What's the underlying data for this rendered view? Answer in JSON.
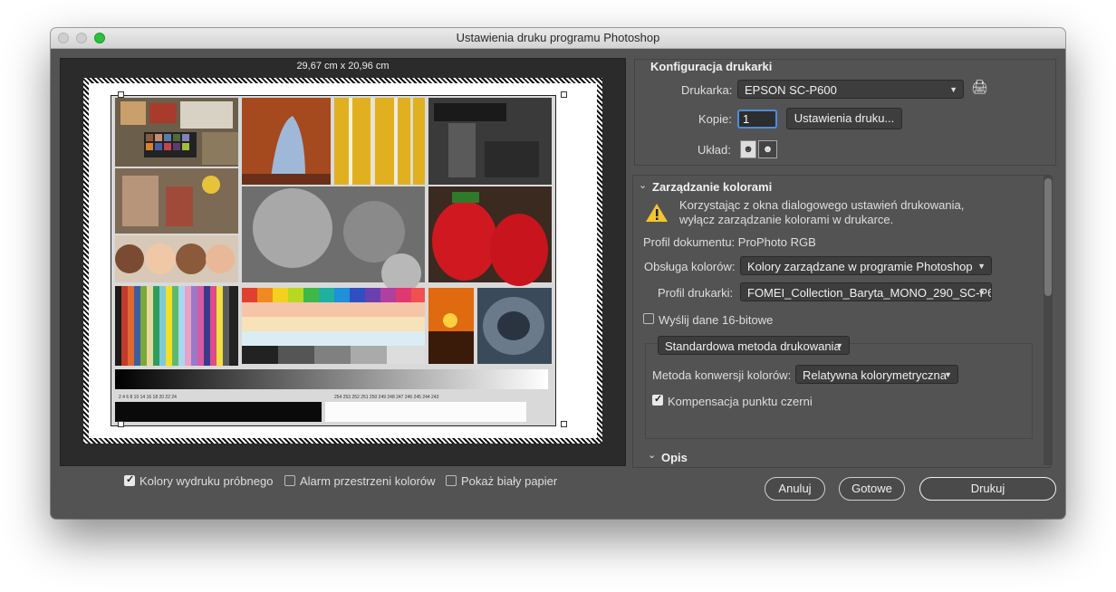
{
  "window": {
    "title": "Ustawienia druku programu Photoshop"
  },
  "preview": {
    "paper_size": "29,67 cm x 20,96 cm"
  },
  "printer_setup": {
    "heading": "Konfiguracja drukarki",
    "printer_label": "Drukarka:",
    "printer_value": "EPSON SC-P600",
    "copies_label": "Kopie:",
    "copies_value": "1",
    "print_settings_button": "Ustawienia druku...",
    "layout_label": "Układ:",
    "add_printer_icon": "add-printer-icon",
    "portrait_icon": "portrait-orientation-icon",
    "landscape_icon": "landscape-orientation-icon"
  },
  "color_management": {
    "heading": "Zarządzanie kolorami",
    "warning_line1": "Korzystając z okna dialogowego ustawień drukowania,",
    "warning_line2": "wyłącz zarządzanie kolorami w drukarce.",
    "doc_profile": "Profil dokumentu: ProPhoto RGB",
    "color_handling_label": "Obsługa kolorów:",
    "color_handling_value": "Kolory zarządzane w programie Photoshop",
    "printer_profile_label": "Profil drukarki:",
    "printer_profile_value": "FOMEI_Collection_Baryta_MONO_290_SC-P6...",
    "send_16bit_label": "Wyślij dane 16-bitowe",
    "send_16bit_checked": false,
    "print_method_value": "Standardowa metoda drukowania",
    "rendering_intent_label": "Metoda konwersji kolorów:",
    "rendering_intent_value": "Relatywna kolorymetryczna",
    "bpc_label": "Kompensacja punktu czerni",
    "bpc_checked": true
  },
  "description": {
    "heading": "Opis"
  },
  "bottom": {
    "proof_colors_label": "Kolory wydruku próbnego",
    "proof_colors_checked": true,
    "gamut_warning_label": "Alarm przestrzeni kolorów",
    "gamut_warning_checked": false,
    "paper_white_label": "Pokaż biały papier",
    "paper_white_checked": false,
    "cancel_button": "Anuluj",
    "done_button": "Gotowe",
    "print_button": "Drukuj"
  },
  "test_chart": {
    "lower_scale": "2 4 6 8 10 14 16 18 20 22 24",
    "upper_scale": "254 253 252 251 250 249 248 247 246 245 244 243"
  },
  "colors": {
    "window_bg": "#535353",
    "panel_dark": "#2b2b2b",
    "warning": "#f4c430"
  }
}
